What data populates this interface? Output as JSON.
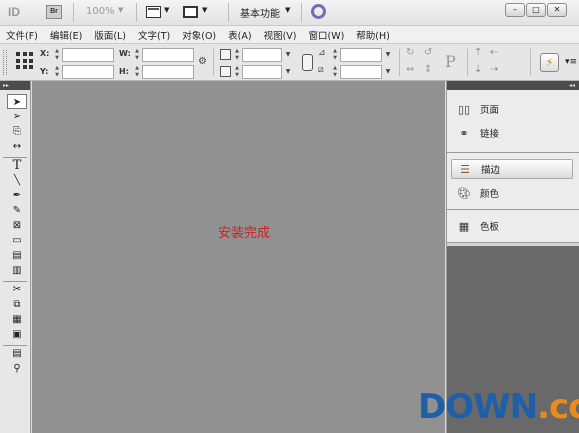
{
  "titlebar": {
    "app_logo": "ID",
    "bridge_label": "Br",
    "zoom": "100%",
    "workspace": "基本功能",
    "window_buttons": [
      "minimize",
      "maximize",
      "close"
    ]
  },
  "menu": [
    "文件(F)",
    "编辑(E)",
    "版面(L)",
    "文字(T)",
    "对象(O)",
    "表(A)",
    "视图(V)",
    "窗口(W)",
    "帮助(H)"
  ],
  "control": {
    "x_label": "X:",
    "y_label": "Y:",
    "w_label": "W:",
    "h_label": "H:"
  },
  "tools": [
    "selection",
    "direct-selection",
    "page",
    "gap",
    "type",
    "line",
    "pen",
    "pencil",
    "rectangle-frame",
    "rectangle",
    "horizontal-grid",
    "vertical-grid",
    "scissors",
    "free-transform",
    "gradient",
    "gradient-feather",
    "note",
    "eyedropper"
  ],
  "canvas": {
    "status_text": "安装完成",
    "status_color": "#cc2222",
    "background": "#919191"
  },
  "panels": {
    "group1": [
      {
        "label": "页面",
        "icon": "pages-icon"
      },
      {
        "label": "链接",
        "icon": "links-icon"
      }
    ],
    "group2": [
      {
        "label": "描边",
        "icon": "stroke-icon",
        "active": true
      },
      {
        "label": "颜色",
        "icon": "color-icon"
      }
    ],
    "group3": [
      {
        "label": "色板",
        "icon": "swatches-icon"
      }
    ]
  },
  "watermark": {
    "part1": "DOWN",
    "part2": ".cc"
  }
}
